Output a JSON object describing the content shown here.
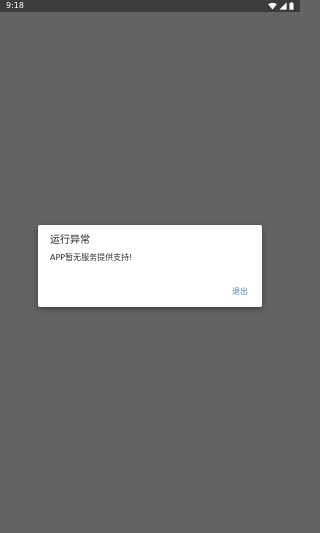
{
  "status_bar": {
    "time": "9:18",
    "icons": [
      "wifi-icon",
      "signal-icon",
      "battery-icon"
    ]
  },
  "dialog": {
    "title": "运行异常",
    "message": "APP暂无服务提供支持!",
    "exit_button": "退出",
    "accent_color": "#3f8fd2"
  }
}
